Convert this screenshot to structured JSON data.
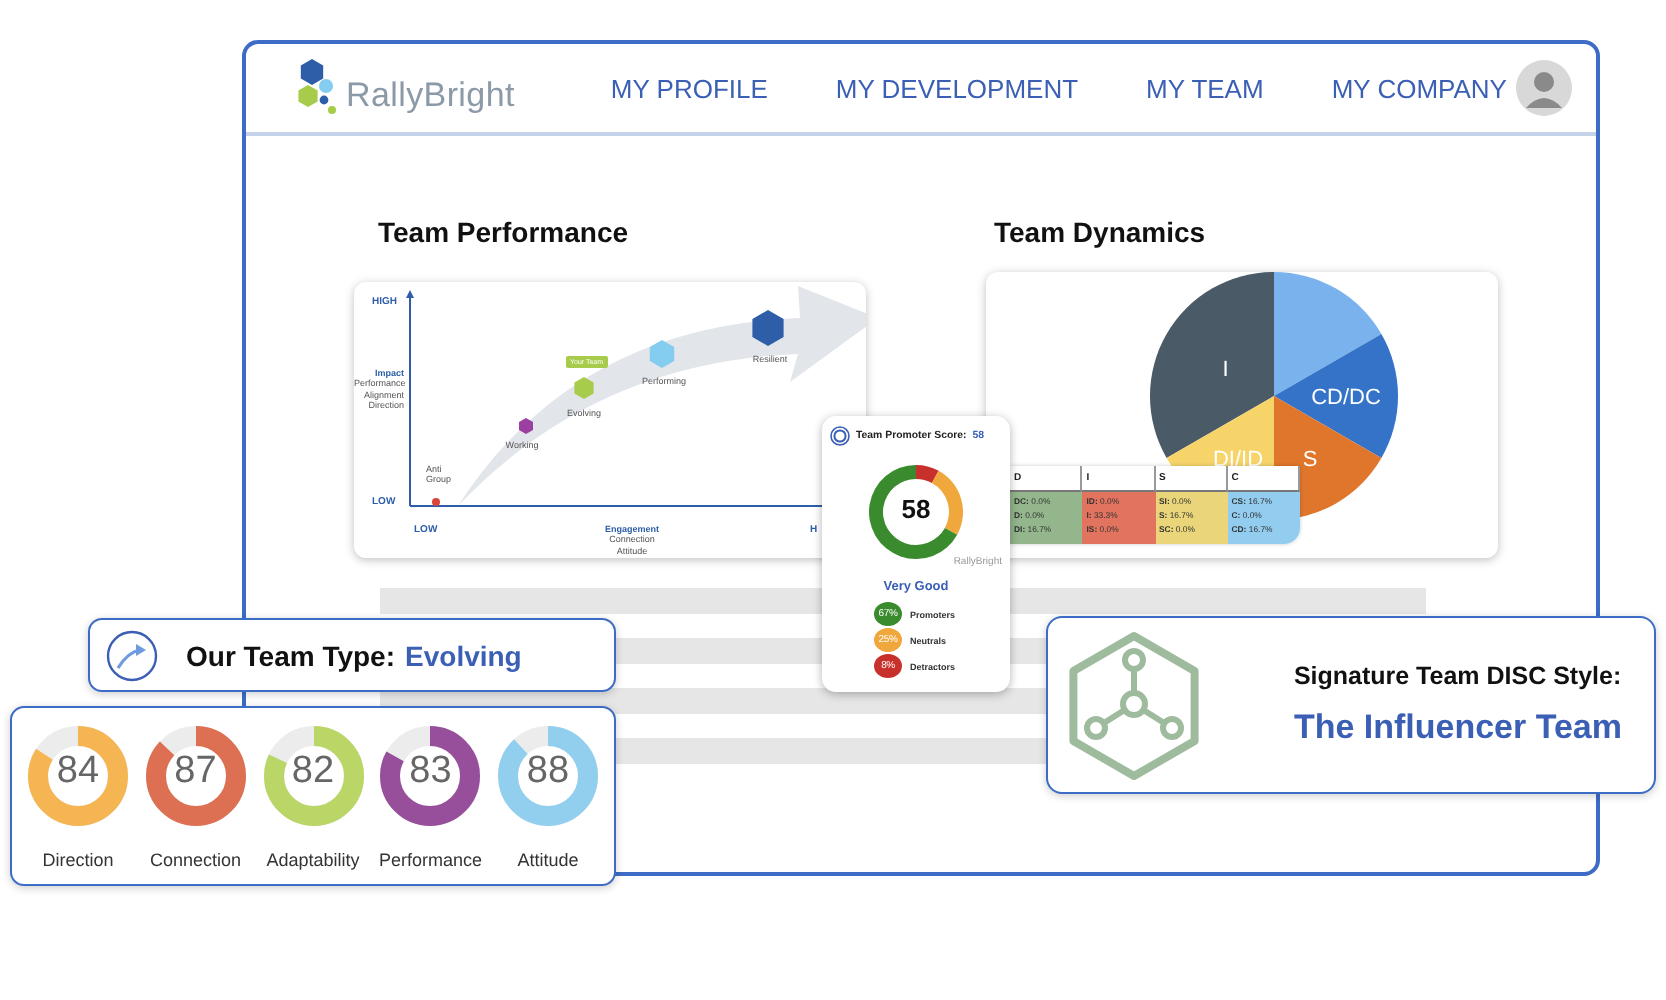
{
  "nav": {
    "logo": "RallyBright",
    "links": [
      "MY PROFILE",
      "MY DEVELOPMENT",
      "MY TEAM",
      "MY COMPANY"
    ]
  },
  "team_performance": {
    "title": "Team Performance",
    "y_high": "HIGH",
    "y_low": "LOW",
    "y_label": "Impact",
    "y_sublabels": [
      "Performance",
      "Alignment",
      "Direction"
    ],
    "x_low": "LOW",
    "x_high": "H",
    "x_label": "Engagement",
    "x_sublabels": [
      "Connection",
      "Attitude"
    ],
    "marker": "Your Team",
    "stages": [
      {
        "label": "Anti Group",
        "color": "#d9453b",
        "current": false
      },
      {
        "label": "Working",
        "color": "#9b3fa0",
        "current": false
      },
      {
        "label": "Evolving",
        "color": "#a7cc4b",
        "current": true
      },
      {
        "label": "Performing",
        "color": "#84cdf0",
        "current": false
      },
      {
        "label": "Resilient",
        "color": "#2f5ea8",
        "current": false
      }
    ]
  },
  "team_dynamics": {
    "title": "Team Dynamics",
    "slices": [
      {
        "label": "I",
        "color": "#4a5a66"
      },
      {
        "color": "#79b2ec"
      },
      {
        "label": "CD/DC",
        "color": "#3573c9"
      },
      {
        "label": "DI/ID",
        "color": "#f6d46a"
      },
      {
        "label": "S",
        "color": "#e0762c"
      }
    ],
    "disc_table": [
      {
        "heading": "D",
        "color": "#93b68c",
        "cells": [
          "**DC:** 0.0%",
          "**D:** 0.0%",
          "**DI:** 16.7%"
        ]
      },
      {
        "heading": "I",
        "color": "#e2735f",
        "cells": [
          "**ID:** 0.0%",
          "**I:** 33.3%",
          "**IS:** 0.0%"
        ]
      },
      {
        "heading": "S",
        "color": "#ead57a",
        "cells": [
          "**SI:** 0.0%",
          "**S:** 16.7%",
          "**SC:** 0.0%"
        ]
      },
      {
        "heading": "C",
        "color": "#92ccef",
        "cells": [
          "**CS:** 16.7%",
          "**C:** 0.0%",
          "**CD:** 16.7%"
        ]
      }
    ]
  },
  "promoter": {
    "title": "Team Promoter Score:",
    "title_score": "58",
    "score": "58",
    "source": "RallyBright",
    "rating": "Very Good",
    "chart_data": {
      "type": "donut",
      "values": [
        67,
        25,
        8
      ]
    },
    "segments": [
      {
        "label": "Promoters",
        "value": "67%",
        "color": "#3a8a2e"
      },
      {
        "label": "Neutrals",
        "value": "25%",
        "color": "#f0a73c"
      },
      {
        "label": "Detractors",
        "value": "8%",
        "color": "#c8312b"
      }
    ]
  },
  "team_type": {
    "label": "Our Team Type:",
    "value": "Evolving"
  },
  "scores": [
    {
      "label": "Direction",
      "value": "84",
      "level": 0.84,
      "color": "#f5b552"
    },
    {
      "label": "Connection",
      "value": "87",
      "level": 0.87,
      "color": "#dd6f52"
    },
    {
      "label": "Adaptability",
      "value": "82",
      "level": 0.82,
      "color": "#b9d667"
    },
    {
      "label": "Performance",
      "value": "83",
      "level": 0.83,
      "color": "#974f9b"
    },
    {
      "label": "Attitude",
      "value": "88",
      "level": 0.88,
      "color": "#92cfee"
    }
  ],
  "disc_style": {
    "label": "Signature Team DISC Style:",
    "value": "The Influencer Team"
  }
}
